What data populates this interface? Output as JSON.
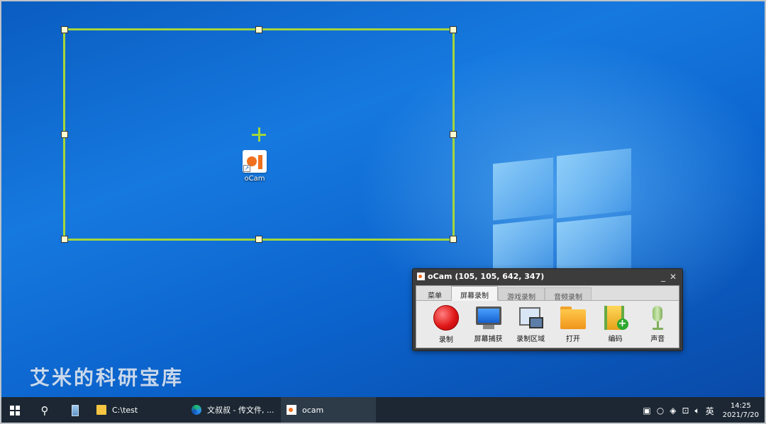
{
  "desktop": {
    "icon_label": "oCam",
    "watermark": "艾米的科研宝库"
  },
  "ocam": {
    "title": "oCam (105, 105, 642, 347)",
    "minimize": "_",
    "close": "✕",
    "tabs": [
      "菜单",
      "屏幕录制",
      "游戏录制",
      "音频录制"
    ],
    "active_tab": "屏幕录制",
    "tools": [
      "录制",
      "屏幕捕获",
      "录制区域",
      "打开",
      "编码",
      "声音"
    ]
  },
  "taskbar": {
    "tasks": [
      {
        "label": "C:\\test"
      },
      {
        "label": "文叔叔 - 传文件, ..."
      },
      {
        "label": "ocam"
      }
    ],
    "ime": "英",
    "time": "14:25",
    "date": "2021/7/20"
  },
  "colors": {
    "selection": "#a4d63a",
    "taskbar": "#1c2733",
    "accent": "#6fb3f0"
  }
}
